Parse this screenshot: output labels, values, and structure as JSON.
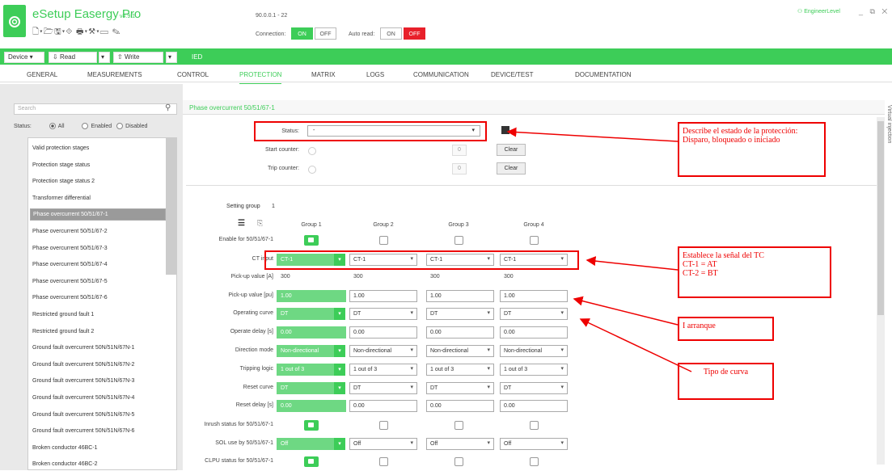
{
  "app": {
    "title": "eSetup Easergy Pro",
    "version": "v4.9.1",
    "ip": "90.0.0.1 - 22",
    "connection_label": "Connection:",
    "conn_on": "ON",
    "conn_off": "OFF",
    "autoread_label": "Auto read:",
    "auto_on": "ON",
    "auto_off": "OFF",
    "user": "EngineerLevel",
    "window_controls": "_ ⧉ ✕",
    "quick_toolbar": "🗋▾🗁🖫▾⟐ 🖶▾⚒▾▭ ✎"
  },
  "toolbar": {
    "device": "Device",
    "read": "Read",
    "write": "Write",
    "ied": "IED"
  },
  "tabs": [
    "GENERAL",
    "MEASUREMENTS",
    "CONTROL",
    "PROTECTION",
    "MATRIX",
    "LOGS",
    "COMMUNICATION",
    "DEVICE/TEST",
    "DOCUMENTATION"
  ],
  "sidebar": {
    "search_placeholder": "Search",
    "status_label": "Status:",
    "filter_all": "All",
    "filter_enabled": "Enabled",
    "filter_disabled": "Disabled",
    "items": [
      "Valid protection stages",
      "Protection stage status",
      "Protection stage status 2",
      "Transformer differential",
      "Phase overcurrent 50/51/67-1",
      "Phase overcurrent 50/51/67-2",
      "Phase overcurrent 50/51/67-3",
      "Phase overcurrent 50/51/67-4",
      "Phase overcurrent 50/51/67-5",
      "Phase overcurrent 50/51/67-6",
      "Restricted ground fault 1",
      "Restricted ground fault 2",
      "Ground fault overcurrent 50N/51N/67N-1",
      "Ground fault overcurrent 50N/51N/67N-2",
      "Ground fault overcurrent 50N/51N/67N-3",
      "Ground fault overcurrent 50N/51N/67N-4",
      "Ground fault overcurrent 50N/51N/67N-5",
      "Ground fault overcurrent 50N/51N/67N-6",
      "Broken conductor 46BC-1",
      "Broken conductor 46BC-2"
    ]
  },
  "main": {
    "title": "Phase overcurrent 50/51/67-1",
    "status_label": "Status:",
    "status_value": "-",
    "start_counter_label": "Start counter:",
    "start_counter_value": "0",
    "trip_counter_label": "Trip counter:",
    "trip_counter_value": "0",
    "clear": "Clear",
    "setting_group_label": "Setting group",
    "setting_group_value": "1",
    "groups": [
      "Group 1",
      "Group 2",
      "Group 3",
      "Group 4"
    ],
    "rows": {
      "enable": "Enable for 50/51/67-1",
      "ct_input": "CT input",
      "pickup_a": "Pick-up value [A]",
      "pickup_pu": "Pick-up value [pu]",
      "curve": "Operating curve",
      "delay": "Operate delay [s]",
      "direction": "Direction mode",
      "logic": "Tripping logic",
      "reset_curve": "Reset curve",
      "reset_delay": "Reset delay [s]",
      "inrush": "Inrush status for 50/51/67-1",
      "sol": "SOL use by 50/51/67-1",
      "clpu": "CLPU status for 50/51/67-1"
    },
    "values": {
      "ct_input": "CT-1",
      "pickup_a": "300",
      "pickup_pu": "1.00",
      "curve": "DT",
      "delay": "0.00",
      "direction": "Non-directional",
      "logic": "1 out of 3",
      "reset_curve": "DT",
      "reset_delay": "0.00",
      "sol": "Off"
    }
  },
  "virtual_injection": "Virtual injection",
  "annotations": {
    "status": "Describe el estado de la protección: Disparo, bloqueado o iniciado",
    "ct": "Establece la señal del TC\nCT-1 = AT\nCT-2 = BT",
    "arranque": "I arranque",
    "curva": "Tipo de curva"
  }
}
